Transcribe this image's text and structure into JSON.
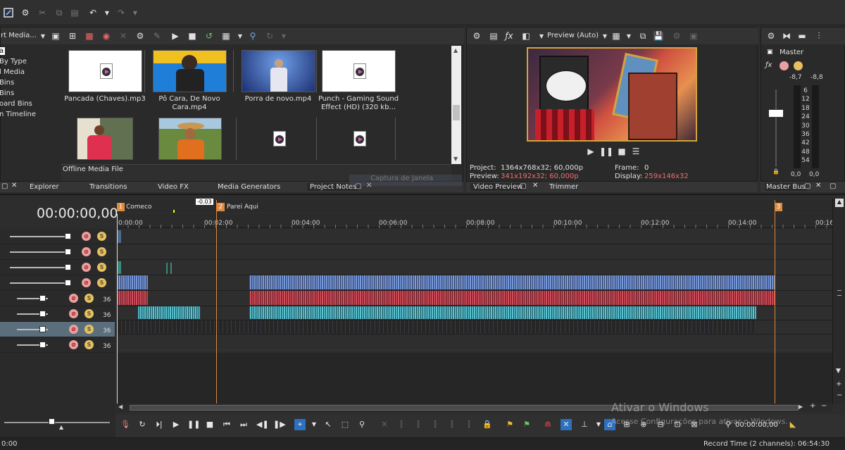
{
  "media_panel": {
    "title": "rt Media...",
    "tree": [
      "a",
      "By Type",
      "l Media",
      "Bins",
      "Bins",
      "oard Bins",
      "n Timeline"
    ],
    "files": [
      {
        "label": "Pancada (Chaves).mp3",
        "kind": "audio"
      },
      {
        "label": "Pô Cara, De Novo Cara.mp4",
        "kind": "video1"
      },
      {
        "label": "Porra de novo.mp4",
        "kind": "video2"
      },
      {
        "label": "Punch - Gaming Sound Effect (HD) (320 kb...",
        "kind": "audio"
      },
      {
        "label": "",
        "kind": "video3"
      },
      {
        "label": "",
        "kind": "video4"
      },
      {
        "label": "",
        "kind": "audio"
      },
      {
        "label": "",
        "kind": "audio"
      }
    ],
    "status": "Offline Media File"
  },
  "tabs_left": [
    "Explorer",
    "Transitions",
    "Video FX",
    "Media Generators",
    "Project Notes"
  ],
  "ghost_tooltip": "Captura de Janela",
  "preview": {
    "mode": "Preview (Auto)",
    "project_label": "Project:",
    "project_value": "1364x768x32; 60,000p",
    "preview_label": "Preview:",
    "preview_value": "341x192x32; 60,000p",
    "frame_label": "Frame:",
    "frame_value": "0",
    "display_label": "Display:",
    "display_value": "259x146x32",
    "tabs": [
      "Video Preview",
      "Trimmer"
    ]
  },
  "master": {
    "title": "Master",
    "left_db": "-8,7",
    "right_db": "-8,8",
    "scale": [
      "6",
      "12",
      "18",
      "24",
      "30",
      "36",
      "42",
      "48",
      "54"
    ],
    "bottom_left": "0,0",
    "bottom_right": "0,0",
    "tab": "Master Bus"
  },
  "timeline": {
    "timecode": "00:00:00,00",
    "markers": [
      {
        "num": "1",
        "label": "Comeco"
      },
      {
        "num": "2",
        "label": "Parei Aqui"
      },
      {
        "num": "3",
        "label": ""
      }
    ],
    "offset_badge": "-0.03",
    "ticks": [
      "0:00:00",
      "00:02:00",
      "00:04:00",
      "00:06:00",
      "00:08:00",
      "00:10:00",
      "00:12:00",
      "00:14:00",
      "00:16"
    ],
    "track_numbers": [
      "36",
      "36",
      "36",
      "36"
    ]
  },
  "transport": {
    "timecode": "00:00:00,00",
    "watermark_title": "Ativar o Windows",
    "watermark_sub": "Acesse Configurações para ativar o Windows."
  },
  "statusbar": {
    "left": "0:00",
    "record": "Record Time (2 channels): 06:54:30"
  },
  "colors": {
    "accent_orange": "#e08a3c",
    "video_blue": "#6b8ccf",
    "audio_red": "#c0444e",
    "audio_teal": "#4fb3c2",
    "preview_red": "#f26b6b"
  }
}
